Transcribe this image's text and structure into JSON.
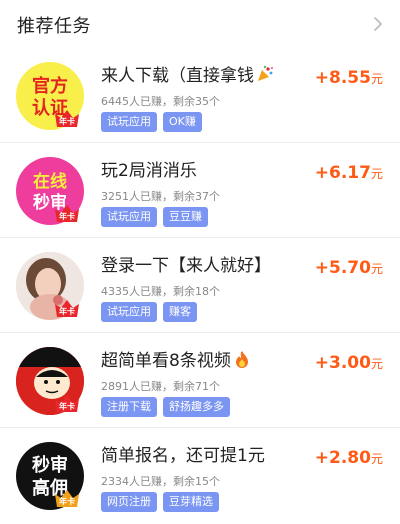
{
  "header": {
    "title": "推荐任务"
  },
  "tasks": [
    {
      "name": "来人下载（直接拿钱",
      "stats": "6445人已赚，剩余35个",
      "tags": [
        "试玩应用",
        "OK赚"
      ],
      "amount": "+8.55",
      "unit": "元",
      "avatar_lines": [
        "官方",
        "认证"
      ],
      "badge": "年卡",
      "emoji": "party-popper-icon"
    },
    {
      "name": "玩2局消消乐",
      "stats": "3251人已赚，剩余37个",
      "tags": [
        "试玩应用",
        "豆豆赚"
      ],
      "amount": "+6.17",
      "unit": "元",
      "avatar_lines": [
        "在线",
        "秒审"
      ],
      "badge": "年卡"
    },
    {
      "name": "登录一下【来人就好】",
      "stats": "4335人已赚，剩余18个",
      "tags": [
        "试玩应用",
        "赚客"
      ],
      "amount": "+5.70",
      "unit": "元",
      "badge": "年卡"
    },
    {
      "name": "超简单看8条视频",
      "stats": "2891人已赚，剩余71个",
      "tags": [
        "注册下载",
        "舒扬趣多多"
      ],
      "amount": "+3.00",
      "unit": "元",
      "badge": "年卡",
      "emoji": "fire-icon"
    },
    {
      "name": "简单报名，还可提1元",
      "stats": "2334人已赚，剩余15个",
      "tags": [
        "网页注册",
        "豆芽精选"
      ],
      "amount": "+2.80",
      "unit": "元",
      "avatar_lines": [
        "秒审",
        "高佣"
      ],
      "badge": "年卡"
    }
  ],
  "colors": {
    "accent_tag": "#7b95f2",
    "reward": "#ff5b16",
    "badge_red": "#e8262c"
  }
}
